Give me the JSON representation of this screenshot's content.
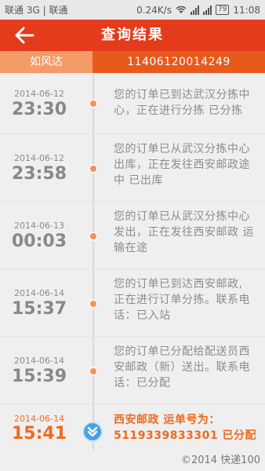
{
  "status_bar": {
    "carrier": "联通 3G | 联通",
    "speed": "0.24K/s",
    "battery": "79",
    "time": "11:08"
  },
  "header": {
    "title": "查询结果",
    "back_icon": "back-arrow-icon"
  },
  "subbar": {
    "company": "如风达",
    "tracking_number": "11406120014249"
  },
  "events": [
    {
      "date": "2014-06-12",
      "time": "23:30",
      "lines": [
        "您的订单已到达武汉分拣中",
        "心，正在进行分拣 已分拣"
      ]
    },
    {
      "date": "2014-06-12",
      "time": "23:58",
      "lines": [
        "您的订单已从武汉分拣中心",
        "出库，正在发往西安邮政途",
        "中 已出库"
      ]
    },
    {
      "date": "2014-06-13",
      "time": "00:03",
      "lines": [
        "您的订单已从武汉分拣中心",
        "发出，正在发往西安邮政 运",
        "输在途"
      ]
    },
    {
      "date": "2014-06-14",
      "time": "15:37",
      "lines": [
        "您的订单已到达西安邮政,",
        "正在进行订单分拣。联系电",
        "话：已入站"
      ]
    },
    {
      "date": "2014-06-14",
      "time": "15:39",
      "lines": [
        "您的订单已分配给配送员西",
        "安邮政（新）送出。联系电",
        "话：已分配"
      ]
    },
    {
      "date": "2014-06-14",
      "time": "15:41",
      "lines": [
        "西安邮政 运单号为：",
        "5119339833301 已分配"
      ]
    }
  ],
  "footer": {
    "copyright": "©2014 快递100"
  },
  "colors": {
    "header_red": "#e33b1c",
    "subbar_orange": "#e85a1c",
    "subbar_light": "#f49b67",
    "accent_orange": "#ee6a1f",
    "latest_dot_blue": "#4aa0e6"
  }
}
